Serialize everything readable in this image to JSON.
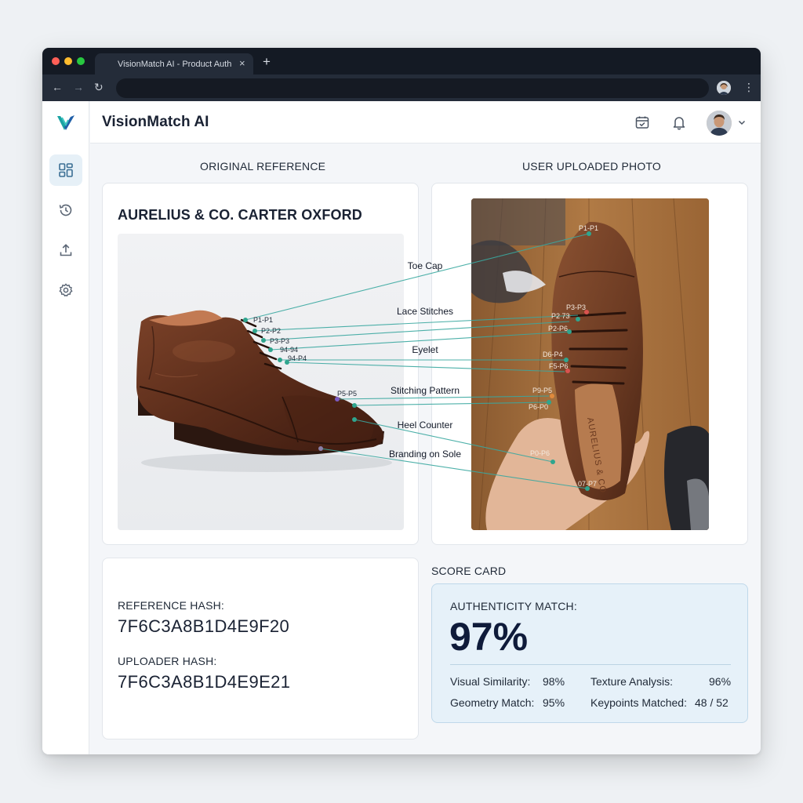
{
  "browser": {
    "tab_title": "VisionMatch AI - Product Auth",
    "tab_close": "×",
    "new_tab": "+",
    "back": "←",
    "forward": "→",
    "reload": "↻",
    "menu": "⋮"
  },
  "app": {
    "title": "VisionMatch AI",
    "sidebar": [
      "dashboard-icon",
      "history-icon",
      "upload-icon",
      "settings-icon"
    ],
    "top_icons": [
      "calendar-check-icon",
      "bell-icon",
      "avatar",
      "chevron-down-icon"
    ]
  },
  "reference": {
    "section_label": "ORIGINAL REFERENCE",
    "product_name": "AURELIUS & CO. CARTER OXFORD"
  },
  "upload": {
    "section_label": "USER UPLOADED PHOTO",
    "sole_branding": "AURELIUS & CO"
  },
  "annotations": {
    "features": [
      "Toe Cap",
      "Lace Stitches",
      "Eyelet",
      "Stitching Pattern",
      "Heel Counter",
      "Branding on Sole"
    ],
    "ref_points": [
      "P1-P1",
      "P2-P2",
      "P3-P3",
      "94-94",
      "94-P4",
      "P5-P5"
    ],
    "upload_points": [
      "P1-P1",
      "P3-P3",
      "P2 73",
      "P2-P6",
      "D6-P4",
      "F5-P6",
      "P9-P5",
      "P6-P0",
      "P0-P6",
      "07-P7"
    ]
  },
  "hashes": {
    "reference_label": "REFERENCE HASH:",
    "reference_value": "7F6C3A8B1D4E9F20",
    "uploader_label": "UPLOADER HASH:",
    "uploader_value": "7F6C3A8B1D4E9E21"
  },
  "score": {
    "section_label": "SCORE CARD",
    "authenticity_label": "AUTHENTICITY MATCH:",
    "authenticity_value": "97%",
    "visual_similarity_label": "Visual Similarity:",
    "visual_similarity_value": "98%",
    "texture_label": "Texture Analysis:",
    "texture_value": "96%",
    "geometry_label": "Geometry Match:",
    "geometry_value": "95%",
    "keypoints_label": "Keypoints Matched:",
    "keypoints_value": "48 / 52"
  },
  "colors": {
    "accent": "#1aa3a3",
    "keypoint_line": "#3aa8a0",
    "score_bg": "#e6f1f9",
    "chrome_dark": "#141a24"
  }
}
